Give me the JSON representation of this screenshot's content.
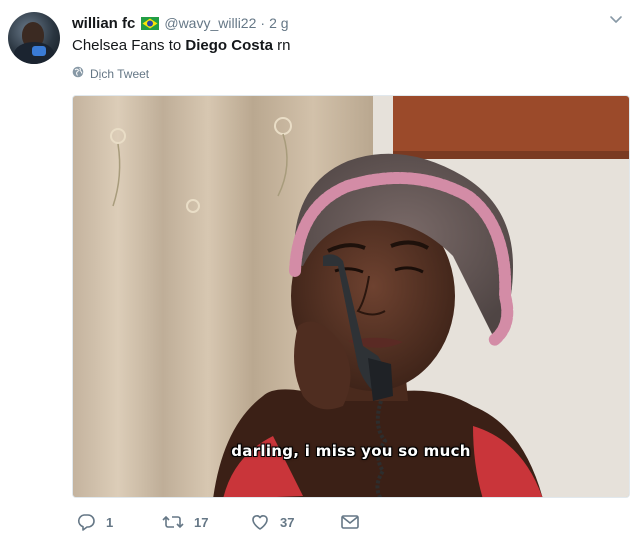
{
  "author": {
    "name": "willian fc",
    "flag": "brazil-flag-icon",
    "handle": "@wavy_willi22",
    "separator": "·",
    "time": "2 g"
  },
  "tweet": {
    "text_before": "Chelsea Fans to ",
    "text_bold": "Diego Costa",
    "text_after": " rn",
    "translate_label": "Dịch Tweet"
  },
  "media": {
    "subtitle": "darling, i miss you so much"
  },
  "actions": {
    "reply_count": "1",
    "retweet_count": "17",
    "like_count": "37"
  },
  "colors": {
    "muted": "#657786",
    "text": "#14171a",
    "border": "#e1e8ed"
  }
}
